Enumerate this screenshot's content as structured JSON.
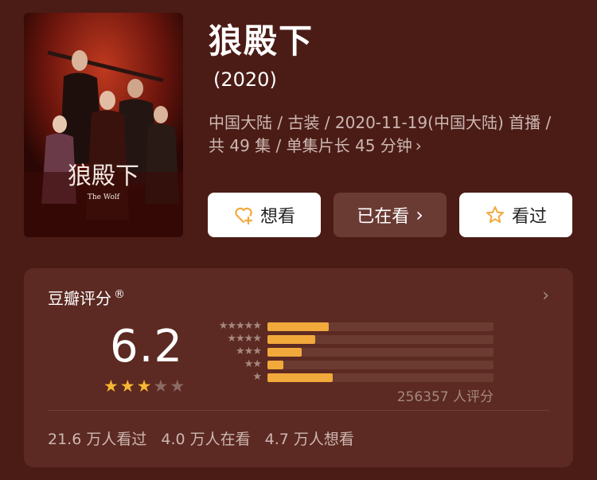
{
  "movie": {
    "title": "狼殿下",
    "year": "(2020)",
    "meta": "中国大陆 / 古装 / 2020-11-19(中国大陆) 首播 / 共 49 集 / 单集片长 45 分钟",
    "meta_chevron": "›",
    "poster_text": "狼殿下",
    "poster_subtext": "The Wolf"
  },
  "actions": {
    "want_label": "想看",
    "watching_label": "已在看",
    "watching_chevron": "›",
    "watched_label": "看过"
  },
  "rating": {
    "header": "豆瓣评分",
    "header_mark": "®",
    "header_chevron": "›",
    "score": "6.2",
    "stars_filled": 3,
    "stars_total": 5,
    "distribution": [
      {
        "stars": "★★★★★",
        "fraction": 0.27
      },
      {
        "stars": "★★★★",
        "fraction": 0.21
      },
      {
        "stars": "★★★",
        "fraction": 0.15
      },
      {
        "stars": "★★",
        "fraction": 0.07
      },
      {
        "stars": "★",
        "fraction": 0.29
      }
    ],
    "votes": "256357 人评分"
  },
  "stats": {
    "watched": "21.6 万人看过",
    "watching": "4.0 万人在看",
    "want": "4.7 万人想看"
  },
  "colors": {
    "background": "#4b1c16",
    "card": "#5c2a22",
    "bar": "#f2a93b",
    "star": "#f7b733"
  }
}
